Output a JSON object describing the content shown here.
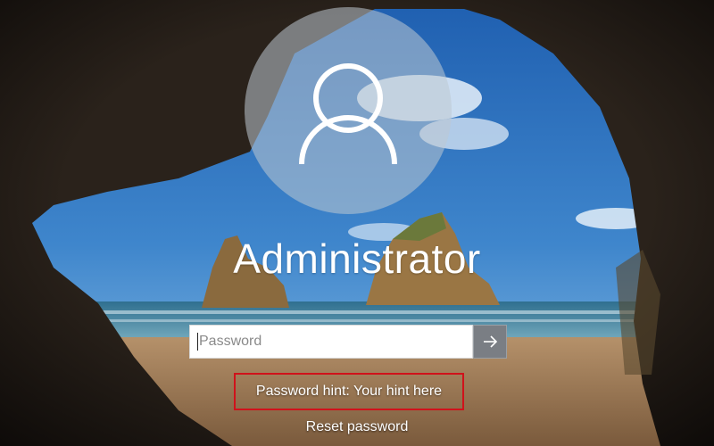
{
  "user": {
    "name": "Administrator",
    "avatar_icon": "user-icon"
  },
  "password": {
    "placeholder": "Password",
    "value": "",
    "submit_icon": "arrow-right-icon"
  },
  "hint": {
    "text": "Password hint: Your hint here",
    "highlight_color": "#d0121b"
  },
  "reset": {
    "label": "Reset password"
  },
  "colors": {
    "text": "#ffffff",
    "submit_button": "#7a7e84"
  }
}
